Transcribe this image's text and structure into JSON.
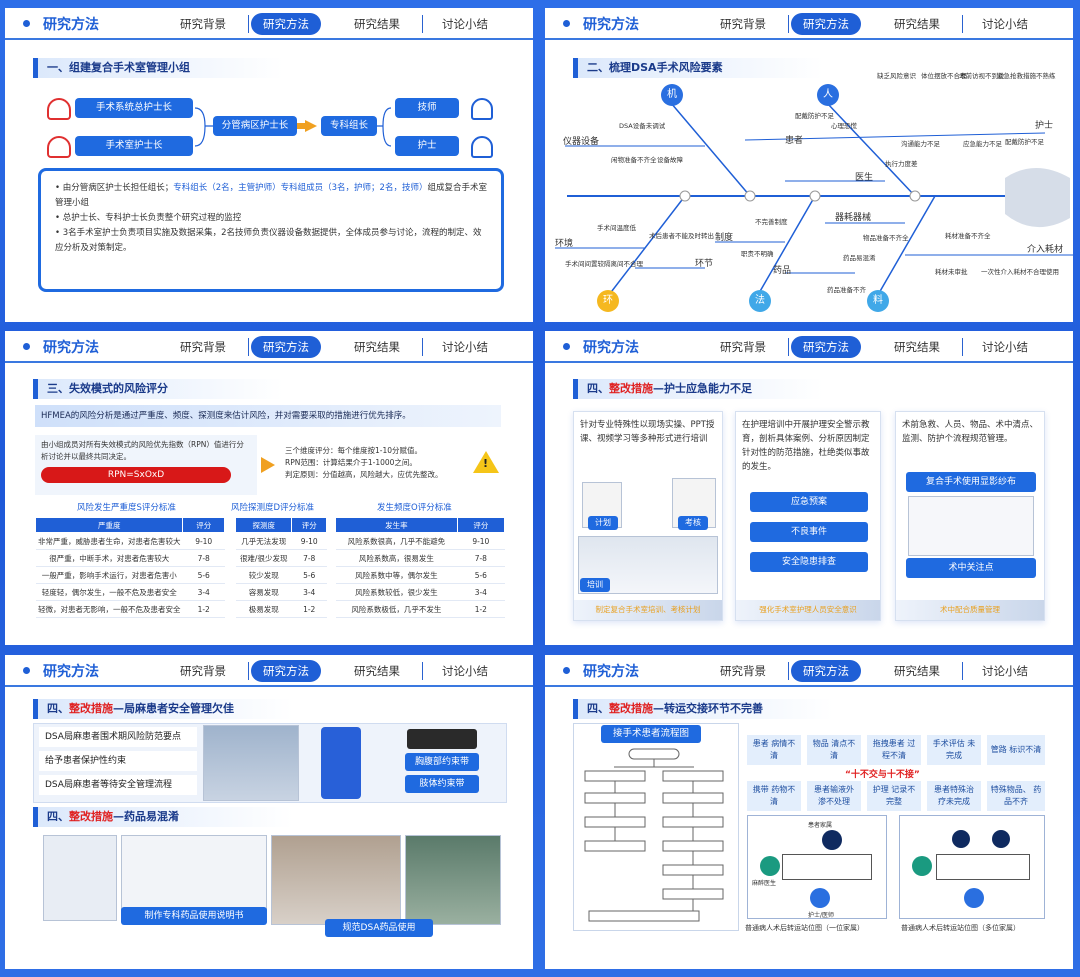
{
  "header": {
    "title": "研究方法",
    "tabs": [
      "研究背景",
      "研究方法",
      "研究结果",
      "讨论小结"
    ]
  },
  "s1": {
    "section": "一、组建复合手术室管理小组",
    "roles": [
      "手术系统总护士长",
      "手术室护士长",
      "分管病区护士长",
      "专科组长",
      "技师",
      "护士"
    ],
    "bullets": [
      {
        "a": "由分管病区护士长担任组长；",
        "b": "专科组长（2名，主管护师）专科组成员（3名，护师；2名，技师）",
        "c": "组成复合手术室管理小组"
      },
      {
        "a": "总护士长、专科护士长负责整个研究过程的监控",
        "b": "",
        "c": ""
      },
      {
        "a": "3名手术室护士负责项目实施及数据采集，2名技师负责仪器设备数据提供，全体成员参与讨论，流程的制定、效应分析及对策制定。",
        "b": "",
        "c": ""
      }
    ]
  },
  "s2": {
    "section": "二、梳理DSA手术风险要素",
    "circles": [
      "机",
      "人",
      "环",
      "法",
      "料"
    ],
    "labels": {
      "instrument": "仪器设备",
      "env": "环境",
      "nurse": "护士",
      "patient": "患者",
      "doctor": "医生",
      "system": "制度",
      "drug": "药品",
      "link": "环节",
      "device": "器耗器械",
      "consumable": "介入耗材"
    },
    "small": [
      "DSA设备未调试",
      "闲物准备不齐全",
      "设备故障",
      "配戴防护不足",
      "心理恐慌",
      "缺乏风险意识",
      "体位摆放不合理",
      "术前访视不到位",
      "紧急抢救措施不熟练",
      "沟通能力不足",
      "应急能力不足",
      "配戴防护不足",
      "执行力度差",
      "手术间温度低",
      "术后患者不能及时转出",
      "手术间间置较隔离间不合理",
      "不完善制度",
      "职责不明确",
      "物品准备不齐全",
      "药品易混淆",
      "药品准备不齐",
      "耗材准备不齐全",
      "耗材未审批",
      "一次性介入耗材不合理使用"
    ]
  },
  "s3": {
    "section": "三、失效模式的风险评分",
    "hfmea": "HFMEA的风险分析是通过严重度、频度、探测度来估计风险，并对需要采取的措施进行优先排序。",
    "left_text": "由小组成员对所有失效模式的风险优先指数（RPN）值进行分析讨论并以最终共同决定。",
    "rpn": "RPN=SxOxD",
    "right1": "三个维度评分：每个维度按1-10分赋值。",
    "right2": "RPN范围：计算结果介于1-1000之间。",
    "right3": "判定原则：分值越高，风险越大，应优先整改。",
    "t1_title": "风险发生严重度S评分标准",
    "t2_title": "风险探测度D评分标准",
    "t3_title": "发生频度O评分标准",
    "t1_head": [
      "严重度",
      "评分"
    ],
    "t2_head": [
      "探测度",
      "评分"
    ],
    "t3_head": [
      "发生率",
      "评分"
    ],
    "t1_rows": [
      [
        "非常严重，威胁患者生命，对患者危害较大",
        "9-10"
      ],
      [
        "很严重，中断手术，对患者危害较大",
        "7-8"
      ],
      [
        "一般严重，影响手术运行，对患者危害小",
        "5-6"
      ],
      [
        "轻度轻，偶尔发生，一般不危及患者安全",
        "3-4"
      ],
      [
        "轻微，对患者无影响，一般不危及患者安全",
        "1-2"
      ]
    ],
    "t2_rows": [
      [
        "几乎无法发现",
        "9-10"
      ],
      [
        "很难/很少发现",
        "7-8"
      ],
      [
        "较少发现",
        "5-6"
      ],
      [
        "容易发现",
        "3-4"
      ],
      [
        "极易发现",
        "1-2"
      ]
    ],
    "t3_rows": [
      [
        "风险系数很高，几乎不能避免",
        "9-10"
      ],
      [
        "风险系数高，很易发生",
        "7-8"
      ],
      [
        "风险系数中等，偶尔发生",
        "5-6"
      ],
      [
        "风险系数较低，很少发生",
        "3-4"
      ],
      [
        "风险系数极低，几乎不发生",
        "1-2"
      ]
    ]
  },
  "s4": {
    "section_a": "四、",
    "section_b": "整改措施",
    "section_c": "—护士应急能力不足",
    "c1": "针对专业特殊性以现场实操、PPT授课、视频学习等多种形式进行培训",
    "c1_tags": [
      "计划",
      "考核",
      "培训"
    ],
    "c2": "在护理培训中开展护理安全警示教育，剖析具体案例、分析原因制定针对性的防范措施，杜绝类似事故的发生。",
    "c2_btns": [
      "应急预案",
      "不良事件",
      "安全隐患排查"
    ],
    "c3": "术前急救、人员、物品、术中清点、监测、防护个流程规范管理。",
    "c3_btns": [
      "复合手术使用显影纱布",
      "术中关注点"
    ],
    "footers": [
      "制定复合手术室培训、考核计划",
      "强化手术室护理人员安全意识",
      "术中配合质量管理"
    ]
  },
  "s5": {
    "section_a": "四、",
    "section_b": "整改措施",
    "section_c": "—局麻患者安全管理欠佳",
    "items": [
      "DSA局麻患者围术期风险防范要点",
      "给予患者保护性约束",
      "DSA局麻患者等待安全管理流程"
    ],
    "tags": [
      "胸腹部约束带",
      "肢体约束带"
    ],
    "section2_c": "—药品易混淆",
    "caps": [
      "制作专科药品使用说明书",
      "规范DSA药品使用"
    ]
  },
  "s6": {
    "section_a": "四、",
    "section_b": "整改措施",
    "section_c": "—转运交接环节不完善",
    "flow_title": "接手术患者流程图",
    "boxes": [
      "患者\n病情不清",
      "物品\n清点不清",
      "拖拽患者\n过程不清",
      "手术评估\n未完成",
      "管路\n标识不清",
      "携带\n药物不清",
      "患者输液外\n渗不处理",
      "护理\n记录不完整",
      "患者特殊治\n疗未完成",
      "特殊物品、\n药品不齐"
    ],
    "motto": "“十不交与十不接”",
    "cap1": "普通病人术后转运站位图（一位家属）",
    "cap2": "普通病人术后转运站位图（多位家属）",
    "d_labels": [
      "患者家属",
      "麻醉医生",
      "护士/医师"
    ]
  }
}
